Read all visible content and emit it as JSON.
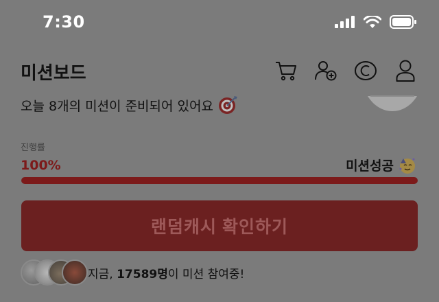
{
  "status_bar": {
    "time": "7:30"
  },
  "header": {
    "title": "미션보드",
    "icons": [
      "cart-icon",
      "add-friend-icon",
      "cash-coin-icon",
      "profile-icon"
    ]
  },
  "subtitle": "오늘 8개의 미션이 준비되어 있어요",
  "progress": {
    "label": "진행률",
    "value": "100%",
    "fraction": 1.0,
    "status_text": "미션성공"
  },
  "cta": {
    "label": "랜덤캐시 확인하기"
  },
  "participants": {
    "prefix": "지금, ",
    "count": "17589명",
    "suffix": "이 미션 참여중!"
  },
  "colors": {
    "accent": "#7c1a1a",
    "button": "#6b2020",
    "overlay_bg": "#7b7b7b"
  }
}
